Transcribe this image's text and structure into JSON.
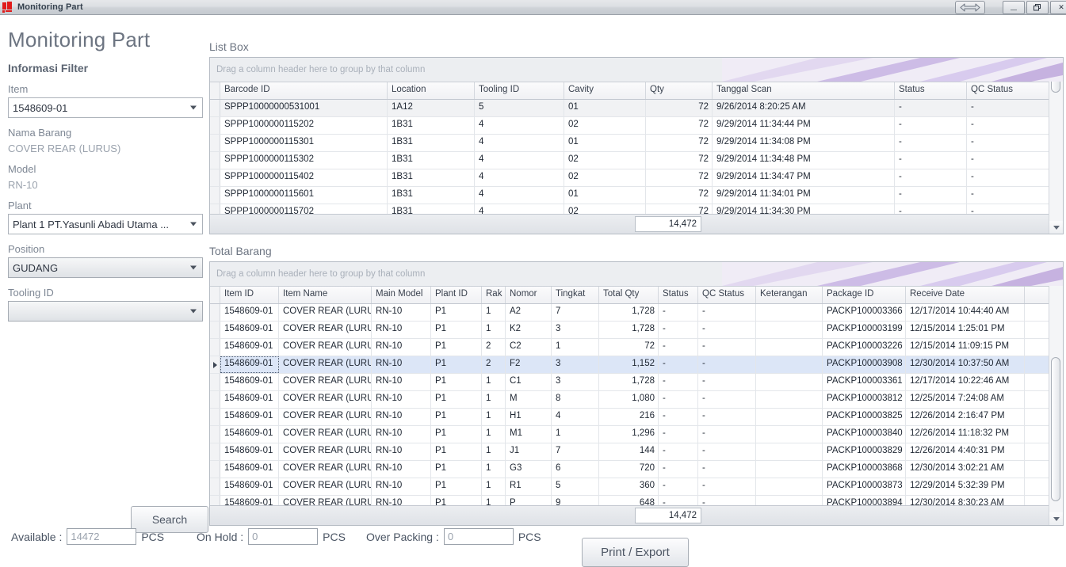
{
  "window": {
    "title": "Monitoring Part",
    "icon": "app-icon",
    "controls": {
      "resize": "resize-arrows-icon",
      "minimize": "—",
      "restore": "❐",
      "close": "✕"
    }
  },
  "sidebar": {
    "heading": "Monitoring Part",
    "section_title": "Informasi Filter",
    "fields": [
      {
        "label": "Item",
        "value": "1548609-01",
        "type": "combo"
      },
      {
        "label": "Nama Barang",
        "value": "COVER REAR (LURUS)",
        "type": "static"
      },
      {
        "label": "Model",
        "value": "RN-10",
        "type": "static"
      },
      {
        "label": "Plant",
        "value": "Plant 1 PT.Yasunli Abadi Utama ...",
        "type": "combo"
      },
      {
        "label": "Position",
        "value": "GUDANG",
        "type": "combo-gray"
      },
      {
        "label": "Tooling ID",
        "value": "",
        "type": "combo-gray"
      }
    ],
    "search_button": "Search"
  },
  "listbox": {
    "title": "List Box",
    "group_hint": "Drag a column header here to group by that column",
    "columns": [
      "Barcode ID",
      "Location",
      "Tooling ID",
      "Cavity",
      "Qty",
      "Tanggal Scan",
      "Status",
      "QC Status"
    ],
    "rows": [
      [
        "SPPP10000000531001",
        "1A12",
        "5",
        "01",
        "72",
        "9/26/2014 8:20:25 AM",
        "-",
        "-"
      ],
      [
        "SPPP1000000115202",
        "1B31",
        "4",
        "02",
        "72",
        "9/29/2014 11:34:44 PM",
        "-",
        "-"
      ],
      [
        "SPPP1000000115301",
        "1B31",
        "4",
        "01",
        "72",
        "9/29/2014 11:34:08 PM",
        "-",
        "-"
      ],
      [
        "SPPP1000000115302",
        "1B31",
        "4",
        "02",
        "72",
        "9/29/2014 11:34:48 PM",
        "-",
        "-"
      ],
      [
        "SPPP1000000115402",
        "1B31",
        "4",
        "02",
        "72",
        "9/29/2014 11:34:47 PM",
        "-",
        "-"
      ],
      [
        "SPPP1000000115601",
        "1B31",
        "4",
        "01",
        "72",
        "9/29/2014 11:34:01 PM",
        "-",
        "-"
      ],
      [
        "SPPP1000000115702",
        "1B31",
        "4",
        "02",
        "72",
        "9/29/2014 11:34:30 PM",
        "-",
        "-"
      ]
    ],
    "summary_total": "14,472"
  },
  "totalbarang": {
    "title": "Total Barang",
    "group_hint": "Drag a column header here to group by that column",
    "columns": [
      "Item ID",
      "Item Name",
      "Main Model",
      "Plant ID",
      "Rak",
      "Nomor",
      "Tingkat",
      "Total Qty",
      "Status",
      "QC Status",
      "Keterangan",
      "Package ID",
      "Receive Date"
    ],
    "rows": [
      [
        "1548609-01",
        "COVER REAR (LURUS)",
        "RN-10",
        "P1",
        "1",
        "A2",
        "7",
        "1,728",
        "-",
        "-",
        "",
        "PACKP100003366",
        "12/17/2014 10:44:40 AM"
      ],
      [
        "1548609-01",
        "COVER REAR (LURUS)",
        "RN-10",
        "P1",
        "1",
        "K2",
        "3",
        "1,728",
        "-",
        "-",
        "",
        "PACKP100003199",
        "12/15/2014 1:25:01 PM"
      ],
      [
        "1548609-01",
        "COVER REAR (LURUS)",
        "RN-10",
        "P1",
        "2",
        "C2",
        "1",
        "72",
        "-",
        "-",
        "",
        "PACKP100003226",
        "12/15/2014 11:09:15 PM"
      ],
      [
        "1548609-01",
        "COVER REAR (LURUS)",
        "RN-10",
        "P1",
        "2",
        "F2",
        "3",
        "1,152",
        "-",
        "-",
        "",
        "PACKP100003908",
        "12/30/2014 10:37:50 AM"
      ],
      [
        "1548609-01",
        "COVER REAR (LURUS)",
        "RN-10",
        "P1",
        "1",
        "C1",
        "3",
        "1,728",
        "-",
        "-",
        "",
        "PACKP100003361",
        "12/17/2014 10:22:46 AM"
      ],
      [
        "1548609-01",
        "COVER REAR (LURUS)",
        "RN-10",
        "P1",
        "1",
        "M",
        "8",
        "1,080",
        "-",
        "-",
        "",
        "PACKP100003812",
        "12/25/2014 7:24:08 AM"
      ],
      [
        "1548609-01",
        "COVER REAR (LURUS)",
        "RN-10",
        "P1",
        "1",
        "H1",
        "4",
        "216",
        "-",
        "-",
        "",
        "PACKP100003825",
        "12/26/2014 2:16:47 PM"
      ],
      [
        "1548609-01",
        "COVER REAR (LURUS)",
        "RN-10",
        "P1",
        "1",
        "M1",
        "1",
        "1,296",
        "-",
        "-",
        "",
        "PACKP100003840",
        "12/26/2014 11:18:32 PM"
      ],
      [
        "1548609-01",
        "COVER REAR (LURUS)",
        "RN-10",
        "P1",
        "1",
        "J1",
        "7",
        "144",
        "-",
        "-",
        "",
        "PACKP100003829",
        "12/26/2014 4:40:31 PM"
      ],
      [
        "1548609-01",
        "COVER REAR (LURUS)",
        "RN-10",
        "P1",
        "1",
        "G3",
        "6",
        "720",
        "-",
        "-",
        "",
        "PACKP100003868",
        "12/30/2014 3:02:21 AM"
      ],
      [
        "1548609-01",
        "COVER REAR (LURUS)",
        "RN-10",
        "P1",
        "1",
        "R1",
        "5",
        "360",
        "-",
        "-",
        "",
        "PACKP100003873",
        "12/29/2014 5:32:39 PM"
      ],
      [
        "1548609-01",
        "COVER REAR (LURUS)",
        "RN-10",
        "P1",
        "1",
        "P",
        "9",
        "648",
        "-",
        "-",
        "",
        "PACKP100003894",
        "12/30/2014 8:30:23 AM"
      ]
    ],
    "selected_row_index": 3,
    "summary_total": "14,472"
  },
  "footer": {
    "available_label": "Available :",
    "available_value": "14472",
    "available_unit": "PCS",
    "onhold_label": "On Hold :",
    "onhold_value": "0",
    "onhold_unit": "PCS",
    "overpacking_label": "Over Packing :",
    "overpacking_value": "0",
    "overpacking_unit": "PCS",
    "print_button": "Print / Export"
  },
  "colors": {
    "selection": "#dce6f7",
    "accent_swoosh": "#b9a6dd",
    "title_text": "#34404d",
    "heading": "#6c7481"
  }
}
